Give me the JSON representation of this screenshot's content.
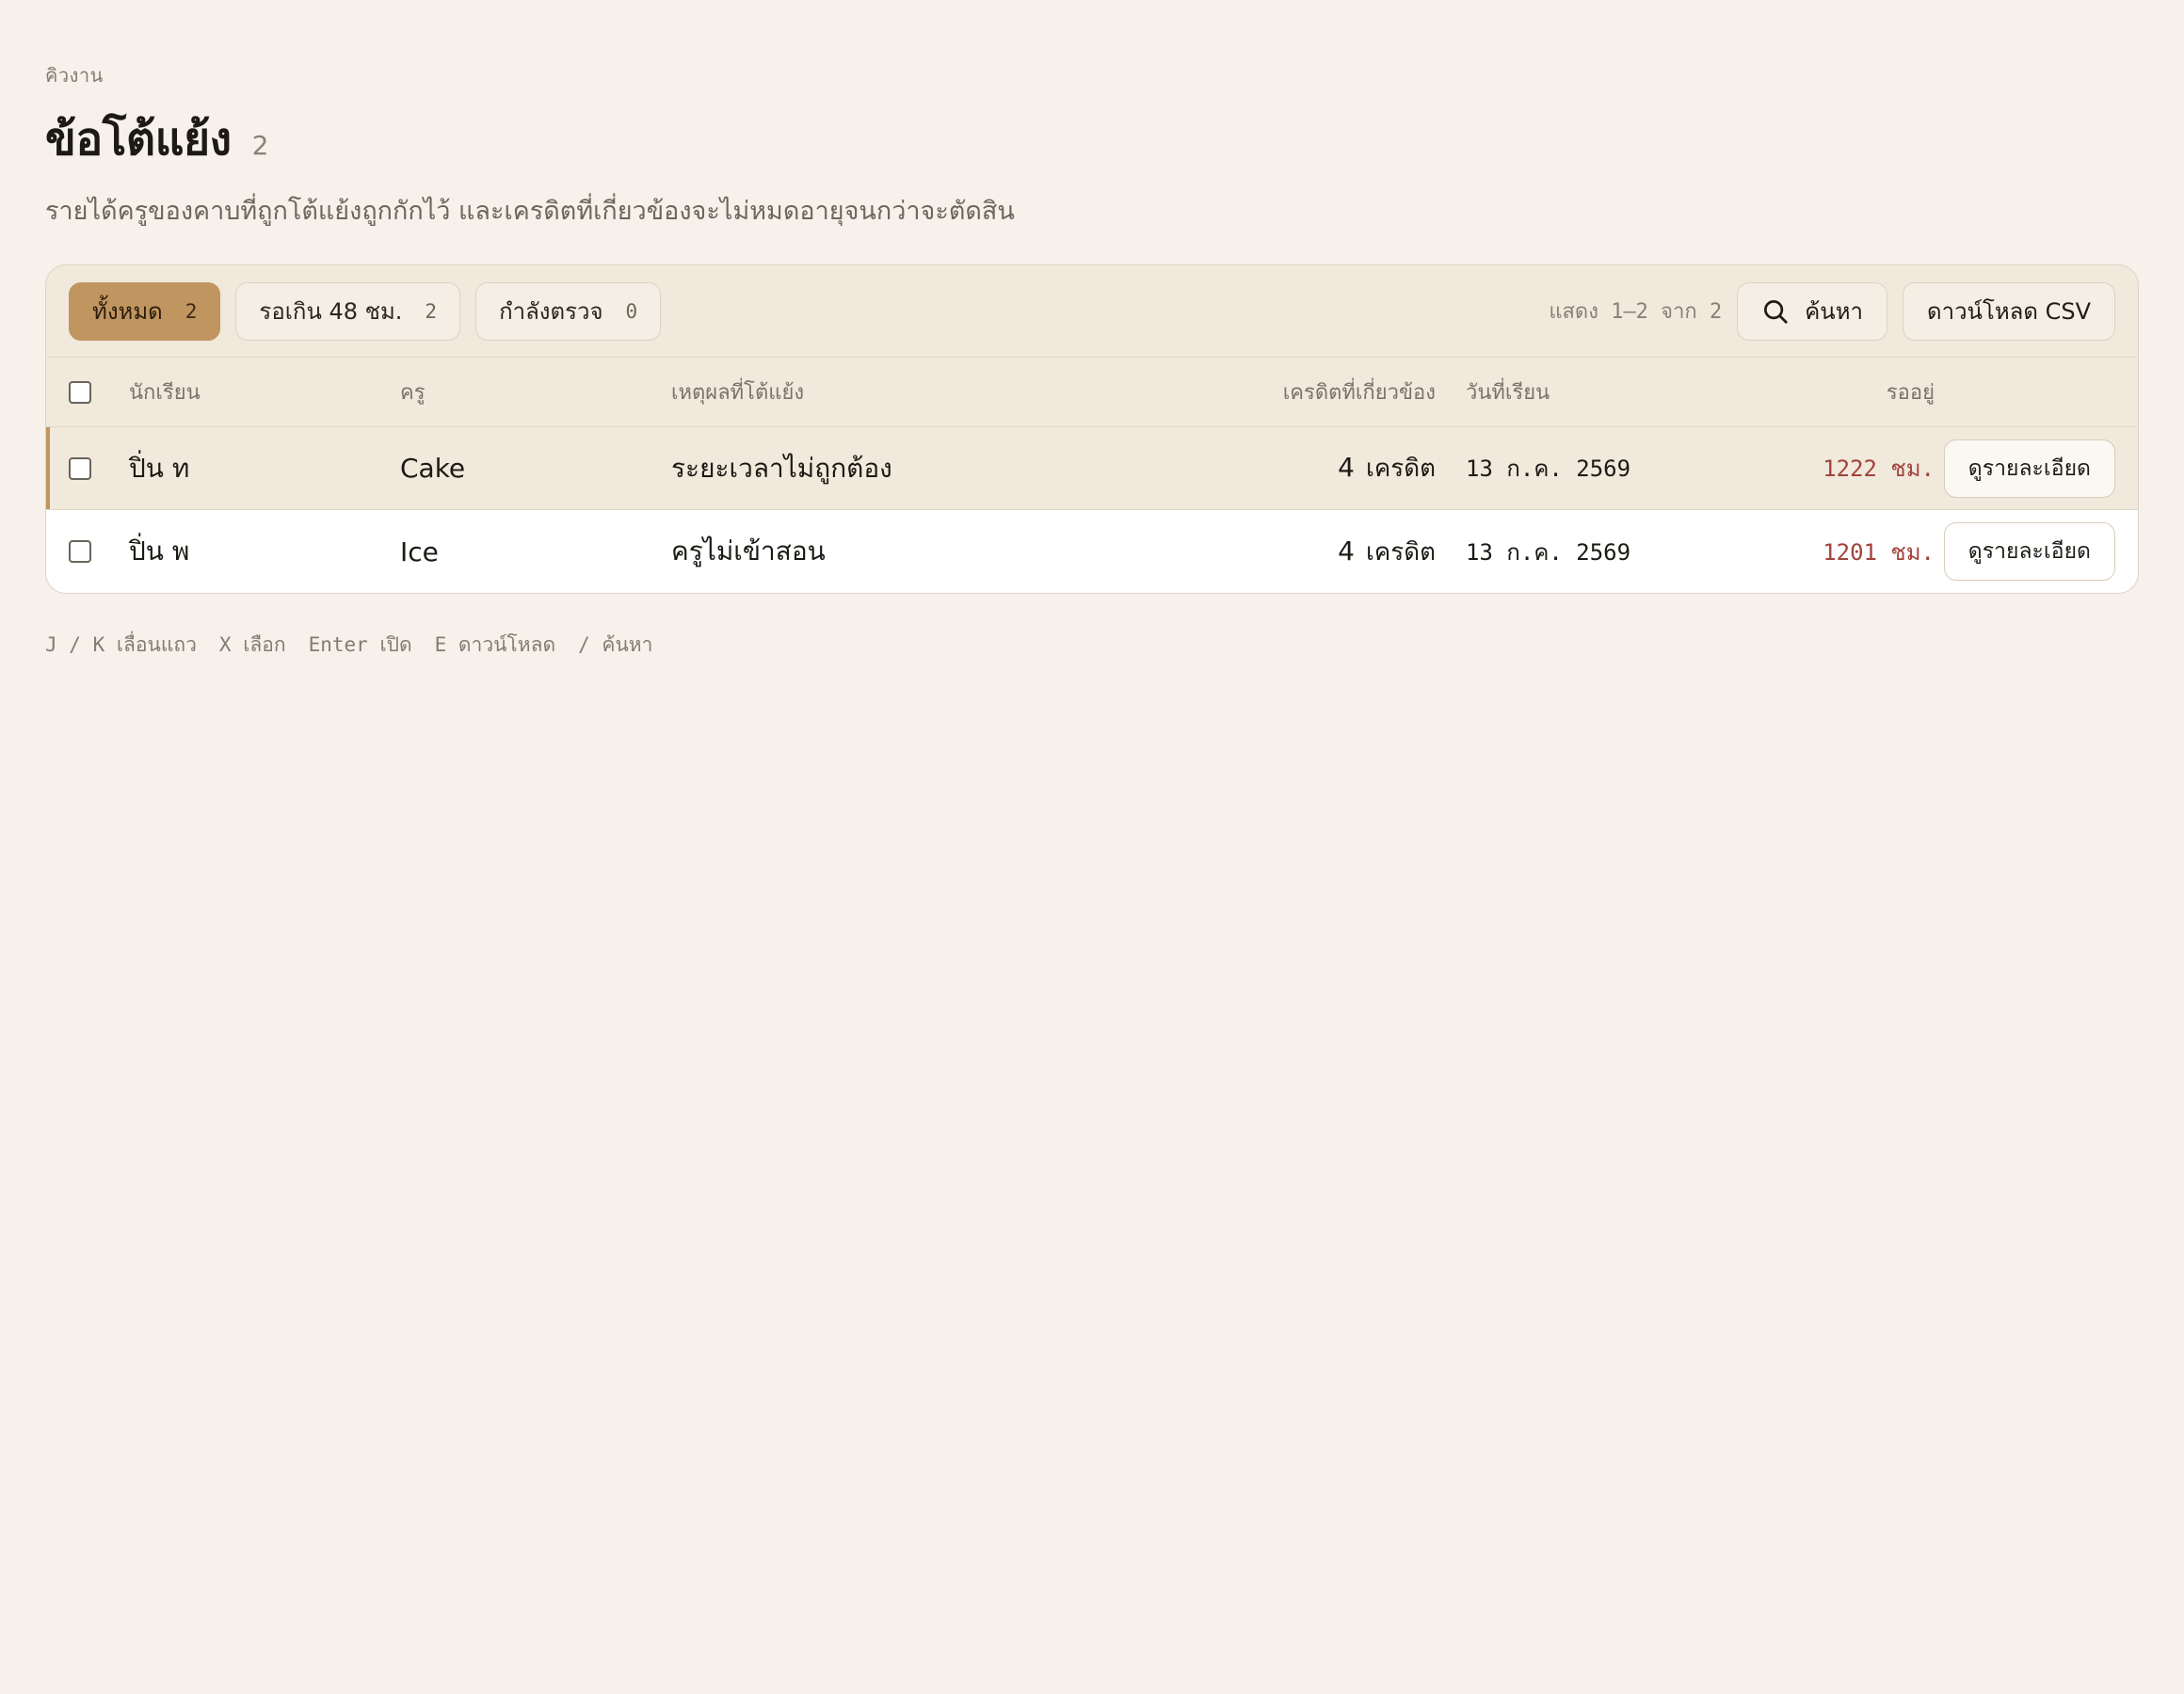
{
  "header": {
    "eyebrow": "คิวงาน",
    "title": "ข้อโต้แย้ง",
    "count": "2",
    "subtitle": "รายได้ครูของคาบที่ถูกโต้แย้งถูกกักไว้ และเครดิตที่เกี่ยวข้องจะไม่หมดอายุจนกว่าจะตัดสิน"
  },
  "filters": [
    {
      "label": "ทั้งหมด",
      "count": "2",
      "active": true
    },
    {
      "label": "รอเกิน 48 ชม.",
      "count": "2",
      "active": false
    },
    {
      "label": "กำลังตรวจ",
      "count": "0",
      "active": false
    }
  ],
  "toolbar": {
    "showing": "แสดง 1–2 จาก 2",
    "search_label": "ค้นหา",
    "download_label": "ดาวน์โหลด CSV"
  },
  "table": {
    "headers": {
      "student": "นักเรียน",
      "teacher": "ครู",
      "reason": "เหตุผลที่โต้แย้ง",
      "credits": "เครดิตที่เกี่ยวข้อง",
      "date": "วันที่เรียน",
      "waiting": "รออยู่"
    },
    "rows": [
      {
        "student": "ปิ่น ท",
        "teacher": "Cake",
        "reason": "ระยะเวลาไม่ถูกต้อง",
        "credits": "4",
        "credit_unit": "เครดิต",
        "date": "13 ก.ค. 2569",
        "waiting": "1222 ชม.",
        "action": "ดูรายละเอียด"
      },
      {
        "student": "ปิ่น พ",
        "teacher": "Ice",
        "reason": "ครูไม่เข้าสอน",
        "credits": "4",
        "credit_unit": "เครดิต",
        "date": "13 ก.ค. 2569",
        "waiting": "1201 ชม.",
        "action": "ดูรายละเอียด"
      }
    ]
  },
  "shortcuts": [
    "J / K เลื่อนแถว",
    "X เลือก",
    "Enter เปิด",
    "E ดาวน์โหลด",
    "/ ค้นหา"
  ],
  "colors": {
    "accent": "#c09560",
    "background": "#f6f1ea",
    "overdue": "#a2433c"
  },
  "icons": {
    "search": "search-icon"
  }
}
